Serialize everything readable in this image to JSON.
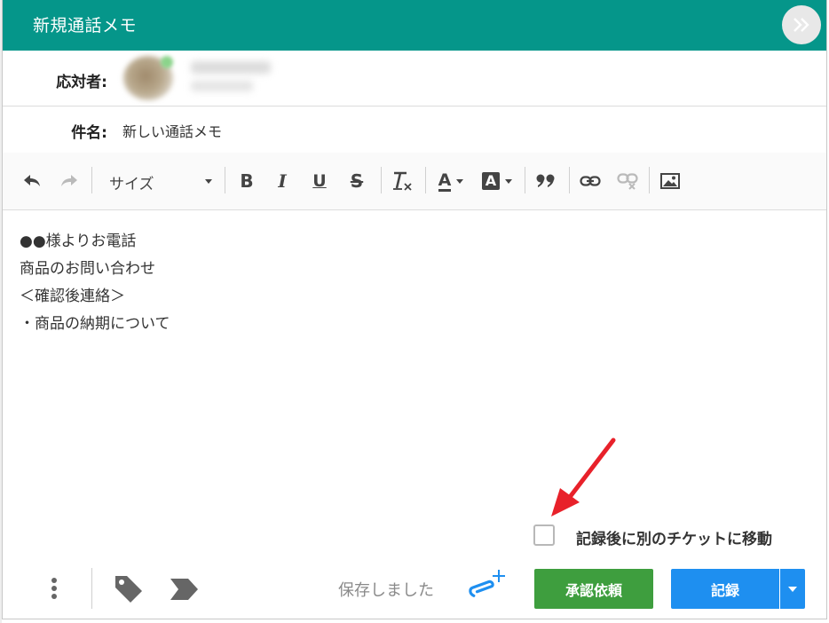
{
  "header": {
    "title": "新規通話メモ"
  },
  "responder": {
    "label": "応対者:"
  },
  "subject": {
    "label": "件名:",
    "value": "新しい通話メモ"
  },
  "toolbar": {
    "items": [
      "undo-icon",
      "redo-icon",
      "bold-icon",
      "italic-icon",
      "underline-icon",
      "strikethrough-icon",
      "clear-format-icon",
      "font-color-icon",
      "background-color-icon",
      "blockquote-icon",
      "link-icon",
      "unlink-icon",
      "image-icon"
    ],
    "size_label": "サイズ",
    "bold": "B",
    "italic": "I",
    "underline": "U",
    "strike": "S",
    "font_color": "A",
    "bg_color": "A"
  },
  "editor": {
    "lines": [
      "●●様よりお電話",
      "商品のお問い合わせ",
      "＜確認後連絡＞",
      "・商品の納期について"
    ]
  },
  "move_after_record": {
    "label": "記録後に別のチケットに移動",
    "checked": false
  },
  "footer": {
    "saved_status": "保存しました",
    "approve_label": "承認依頼",
    "record_label": "記録"
  },
  "colors": {
    "header": "#05968a",
    "approve": "#3e9e3e",
    "record": "#1e8ff0",
    "annotation_arrow": "#e8212a",
    "attach_icon": "#1e8ff0"
  }
}
